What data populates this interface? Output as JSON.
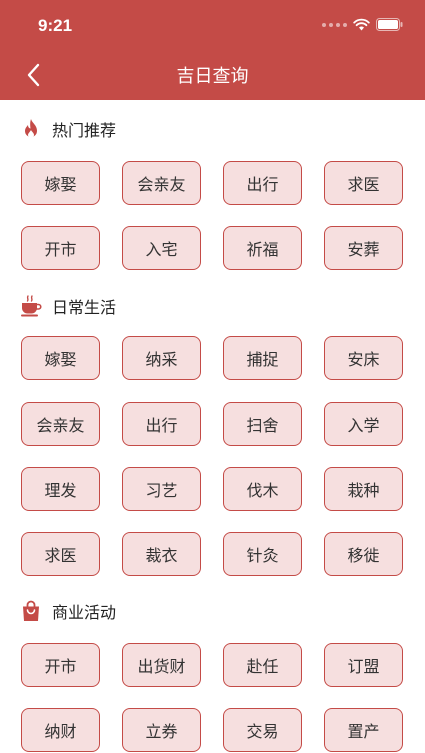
{
  "status": {
    "time": "9:21"
  },
  "nav": {
    "title": "吉日查询"
  },
  "sections": [
    {
      "title": "热门推荐",
      "icon": "fire-icon",
      "tags": [
        "嫁娶",
        "会亲友",
        "出行",
        "求医",
        "开市",
        "入宅",
        "祈福",
        "安葬"
      ]
    },
    {
      "title": "日常生活",
      "icon": "tea-cup-icon",
      "tags": [
        "嫁娶",
        "纳采",
        "捕捉",
        "安床",
        "会亲友",
        "出行",
        "扫舍",
        "入学",
        "理发",
        "习艺",
        "伐木",
        "栽种",
        "求医",
        "裁衣",
        "针灸",
        "移徙"
      ]
    },
    {
      "title": "商业活动",
      "icon": "shopping-bag-icon",
      "tags": [
        "开市",
        "出货财",
        "赴任",
        "订盟",
        "纳财",
        "立券",
        "交易",
        "置产"
      ]
    }
  ],
  "colors": {
    "accent": "#c44b47",
    "tag_bg": "#f6dfdf"
  }
}
